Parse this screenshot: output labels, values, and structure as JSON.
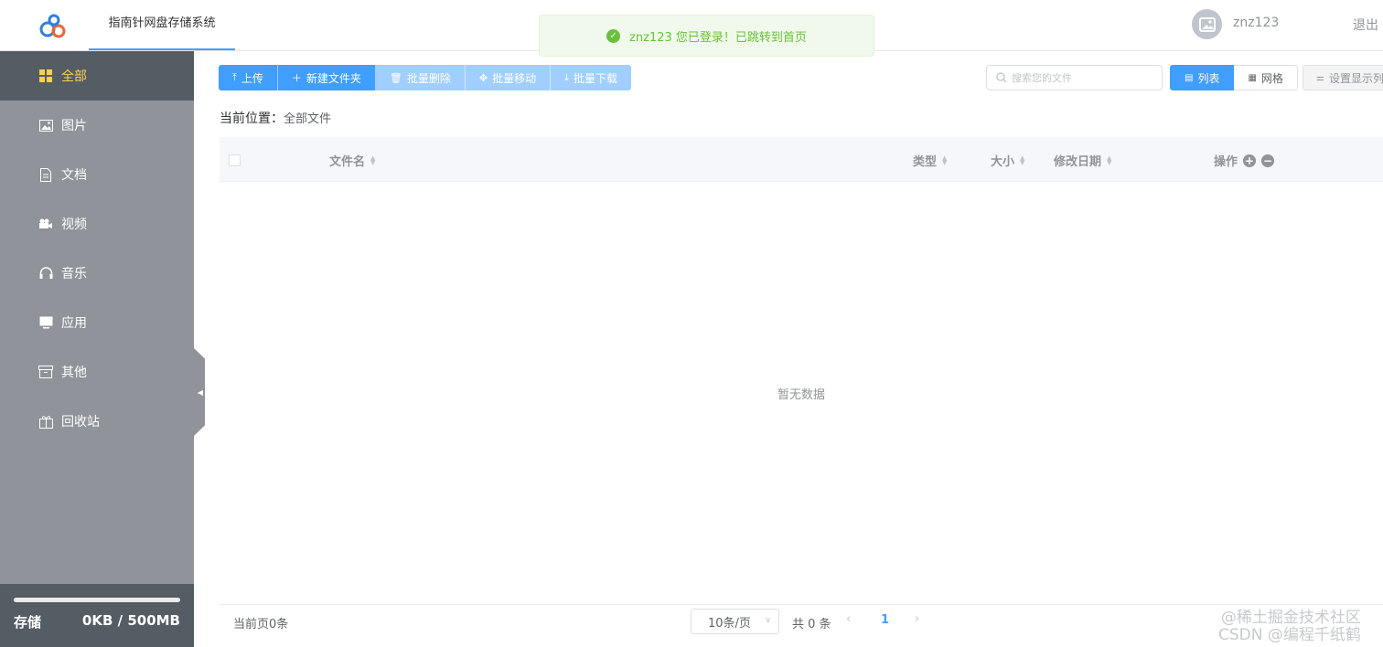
{
  "header": {
    "app_title": "指南针网盘存储系统",
    "toast": "znz123 您已登录！已跳转到首页",
    "username": "znz123",
    "logout": "退出"
  },
  "sidebar": {
    "items": [
      {
        "label": "全部",
        "icon": "grid-icon",
        "active": true
      },
      {
        "label": "图片",
        "icon": "image-icon"
      },
      {
        "label": "文档",
        "icon": "document-icon"
      },
      {
        "label": "视频",
        "icon": "video-icon"
      },
      {
        "label": "音乐",
        "icon": "headphones-icon"
      },
      {
        "label": "应用",
        "icon": "monitor-icon"
      },
      {
        "label": "其他",
        "icon": "archive-icon"
      },
      {
        "label": "回收站",
        "icon": "gift-box-icon"
      }
    ],
    "storage": {
      "label": "存储",
      "value": "0KB / 500MB",
      "used_fraction": 0
    }
  },
  "toolbar": {
    "upload": "上传",
    "new_folder": "新建文件夹",
    "batch_delete": "批量删除",
    "batch_move": "批量移动",
    "batch_download": "批量下载",
    "search_placeholder": "搜索您的文件",
    "view_list": "列表",
    "view_grid": "网格",
    "settings": "设置显示列"
  },
  "breadcrumb": {
    "label": "当前位置：",
    "path": "全部文件"
  },
  "table": {
    "columns": {
      "name": "文件名",
      "type": "类型",
      "size": "大小",
      "modified": "修改日期",
      "actions": "操作"
    },
    "empty_text": "暂无数据"
  },
  "pagination": {
    "current_count": "当前页0条",
    "page_size": "10条/页",
    "total": "共 0 条",
    "current_page": "1"
  },
  "watermark": {
    "line1": "@稀土掘金技术社区",
    "line2": "CSDN @编程千纸鹤"
  },
  "colors": {
    "primary": "#409eff",
    "success": "#67c23a",
    "sidebar": "#909399",
    "sidebar_active": "#545c64",
    "active_text": "#ffd04b"
  }
}
